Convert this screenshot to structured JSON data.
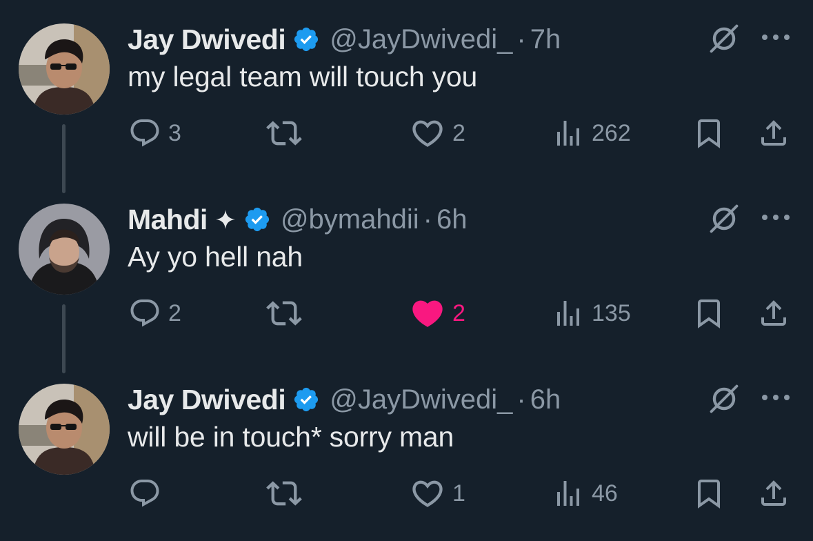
{
  "colors": {
    "background": "#15202b",
    "primary_text": "#e7e9ea",
    "secondary_text": "#8b98a5",
    "verified_blue": "#1d9bf0",
    "like_pink": "#f91880",
    "thread_line": "#3d4852"
  },
  "tweets": [
    {
      "author": {
        "name": "Jay Dwivedi",
        "verified": true,
        "handle": "@JayDwivedi_",
        "avatar_icon": "avatar-sunglasses-photo"
      },
      "separator": "·",
      "time": "7h",
      "text": "my legal team will touch you",
      "actions": {
        "replies": "3",
        "reposts": "",
        "likes": "2",
        "liked": false,
        "views": "262"
      }
    },
    {
      "author": {
        "name": "Mahdi",
        "badge_icon": "sparkle-icon",
        "verified": true,
        "handle": "@bymahdii",
        "avatar_icon": "avatar-hoodie-photo"
      },
      "separator": "·",
      "time": "6h",
      "text": "Ay yo hell nah",
      "actions": {
        "replies": "2",
        "reposts": "",
        "likes": "2",
        "liked": true,
        "views": "135"
      }
    },
    {
      "author": {
        "name": "Jay Dwivedi",
        "verified": true,
        "handle": "@JayDwivedi_",
        "avatar_icon": "avatar-sunglasses-photo"
      },
      "separator": "·",
      "time": "6h",
      "text": "will be in touch* sorry man",
      "actions": {
        "replies": "",
        "reposts": "",
        "likes": "1",
        "liked": false,
        "views": "46"
      }
    }
  ]
}
